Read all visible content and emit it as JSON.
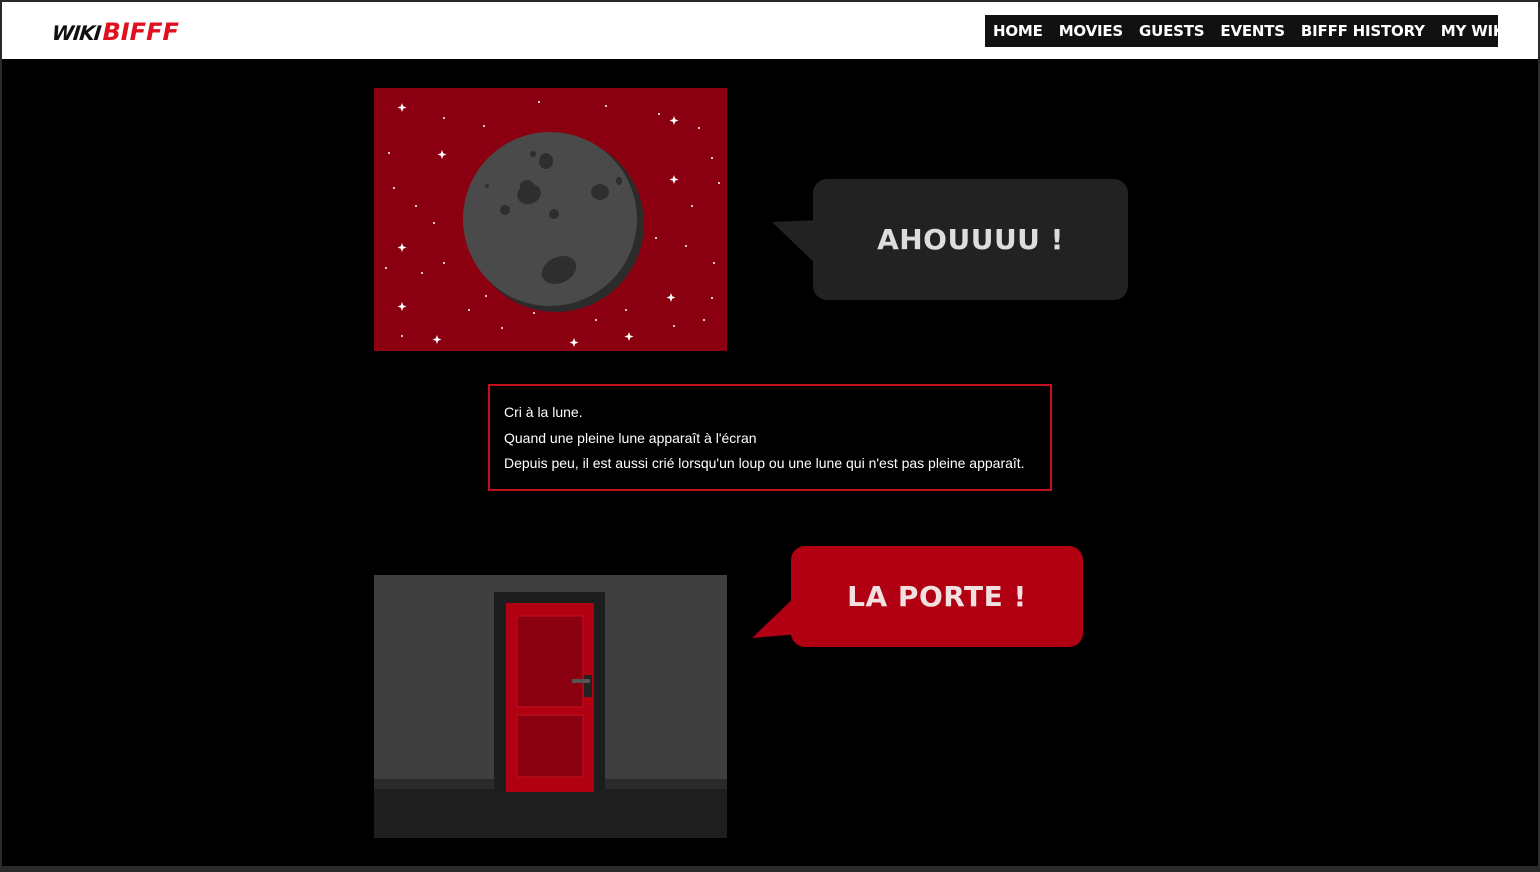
{
  "header": {
    "logo_wiki": "WIKI",
    "logo_bifff": "BIFFF"
  },
  "nav": {
    "items": [
      "HOME",
      "MOVIES",
      "GUESTS",
      "EVENTS",
      "BIFFF HISTORY",
      "MY WIKI"
    ],
    "caret": "▾"
  },
  "bubbles": {
    "moon_shout": "AHOUUUU !",
    "door_shout": "LA PORTE !"
  },
  "description": {
    "lines": [
      "Cri à la lune.",
      "Quand une pleine lune apparaît à l'écran",
      "Depuis peu, il est aussi crié lorsqu'un loup ou une lune qui n'est pas pleine apparaît."
    ]
  },
  "colors": {
    "brand_red": "#e0101e",
    "moon_bg": "#8a0010",
    "bubble_dark": "#222222",
    "bubble_red": "#b00012",
    "door_red": "#b00012"
  },
  "icons": [
    "moon-illustration",
    "door-illustration",
    "star-icon",
    "chevron-down-icon"
  ]
}
